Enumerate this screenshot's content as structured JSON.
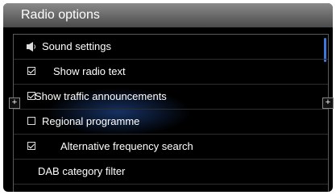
{
  "title": "Radio options",
  "items": [
    {
      "label": "Sound settings",
      "type": "submenu",
      "icon": "speaker-icon"
    },
    {
      "label": "Show radio text",
      "type": "checkbox",
      "checked": true
    },
    {
      "label": "Show traffic announcements",
      "type": "checkbox",
      "checked": true
    },
    {
      "label": "Regional programme",
      "type": "checkbox",
      "checked": false
    },
    {
      "label": "Alternative frequency search",
      "type": "checkbox",
      "checked": true
    },
    {
      "label": "DAB category filter",
      "type": "submenu"
    }
  ],
  "side_buttons": {
    "left": "+",
    "right": "+"
  },
  "colors": {
    "accent": "#3b78d8",
    "background": "#000000",
    "titlebar": "#6a6a6a"
  }
}
